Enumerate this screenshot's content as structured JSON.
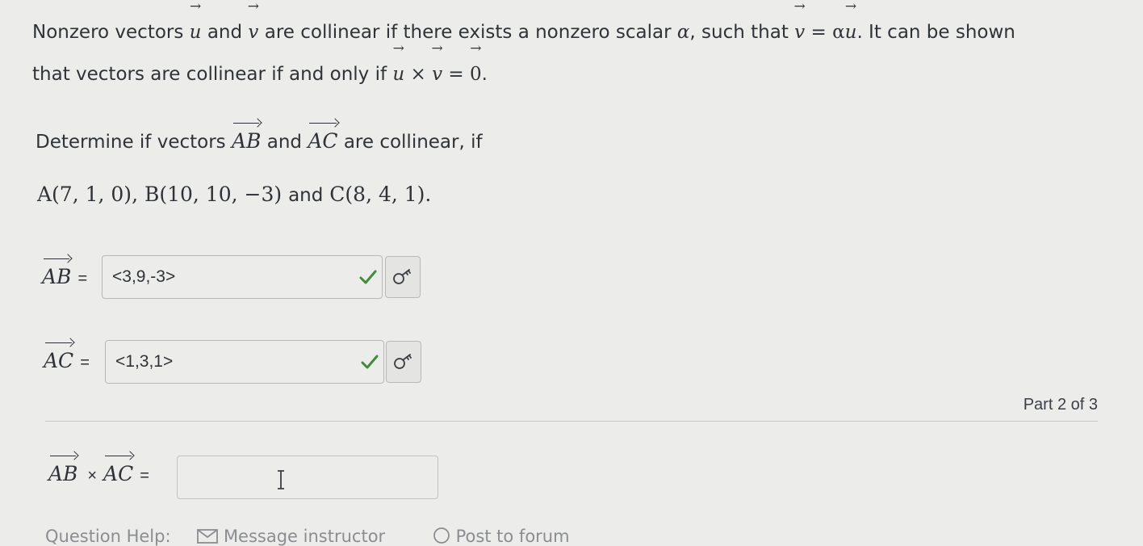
{
  "intro": {
    "p1": "Nonzero vectors",
    "u": "u",
    "and1": "and",
    "v": "v",
    "p2": "are collinear if there exists a nonzero scalar",
    "alpha": "α",
    "p3": ", such that",
    "eq1": " = α",
    "p4": ". It can be shown",
    "line2": "that vectors are collinear if and only if",
    "times": " × ",
    "eq2": " = ",
    "zero": "0",
    "period": "."
  },
  "question": {
    "determine": "Determine if vectors",
    "ab": "AB",
    "and": "and",
    "ac": "AC",
    "tail": "are collinear, if",
    "points": "A(7, 1, 0), B(10, 10, −3)",
    "and_word": "and",
    "point_c": "C(8, 4, 1)."
  },
  "rows": {
    "ab_label": "AB",
    "ac_label": "AC",
    "eq": "=",
    "ab_value": "<3,9,-3>",
    "ac_value": "<1,3,1>",
    "cross_ab": "AB",
    "cross_times": "×",
    "cross_ac": "AC"
  },
  "part": "Part 2 of 3",
  "footer": {
    "help": "Question Help:",
    "message": "Message instructor",
    "post": "Post to forum"
  },
  "colors": {
    "check": "#3d8d3d",
    "text": "#2f3338"
  }
}
